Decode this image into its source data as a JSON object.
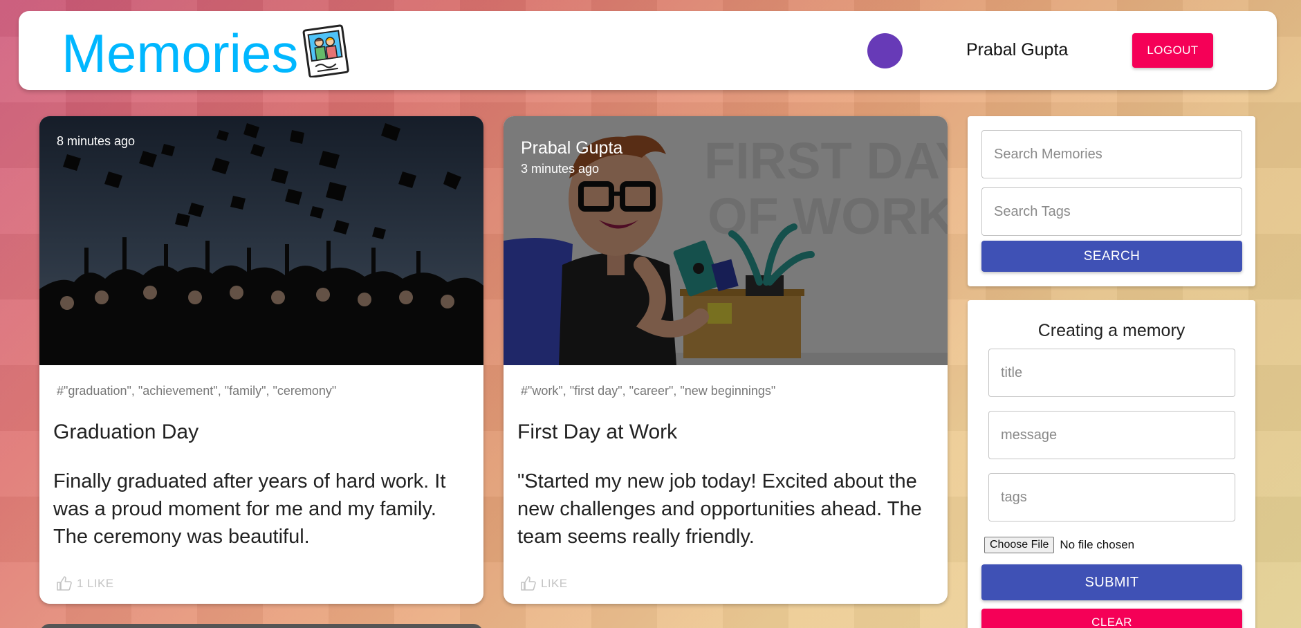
{
  "header": {
    "brand": "Memories",
    "username": "Prabal Gupta",
    "logout_label": "LOGOUT",
    "avatar_color": "#673ab7"
  },
  "posts": [
    {
      "creator": "",
      "time": "8 minutes ago",
      "tags": "#\"graduation\", \"achievement\", \"family\", \"ceremony\"",
      "title": "Graduation Day",
      "message": "Finally graduated after years of hard work. It was a proud moment for me and my family. The ceremony was beautiful.",
      "like_label": "1 LIKE",
      "image": "graduation-photo"
    },
    {
      "creator": "Prabal Gupta",
      "time": "3 minutes ago",
      "tags": "#\"work\", \"first day\", \"career\", \"new beginnings\"",
      "title": "First Day at Work",
      "message": "\"Started my new job today! Excited about the new challenges and opportunities ahead. The team seems really friendly.",
      "like_label": "LIKE",
      "image": "first-day-of-work-illustration"
    }
  ],
  "search": {
    "memories_placeholder": "Search Memories",
    "tags_placeholder": "Search Tags",
    "button_label": "SEARCH"
  },
  "form": {
    "heading": "Creating a memory",
    "title_placeholder": "title",
    "message_placeholder": "message",
    "tags_placeholder": "tags",
    "file_button": "Choose File",
    "file_status": "No file chosen",
    "submit_label": "SUBMIT",
    "clear_label": "CLEAR"
  },
  "colors": {
    "brand": "#00b7ff",
    "primary": "#3f51b5",
    "secondary": "#f50057"
  }
}
